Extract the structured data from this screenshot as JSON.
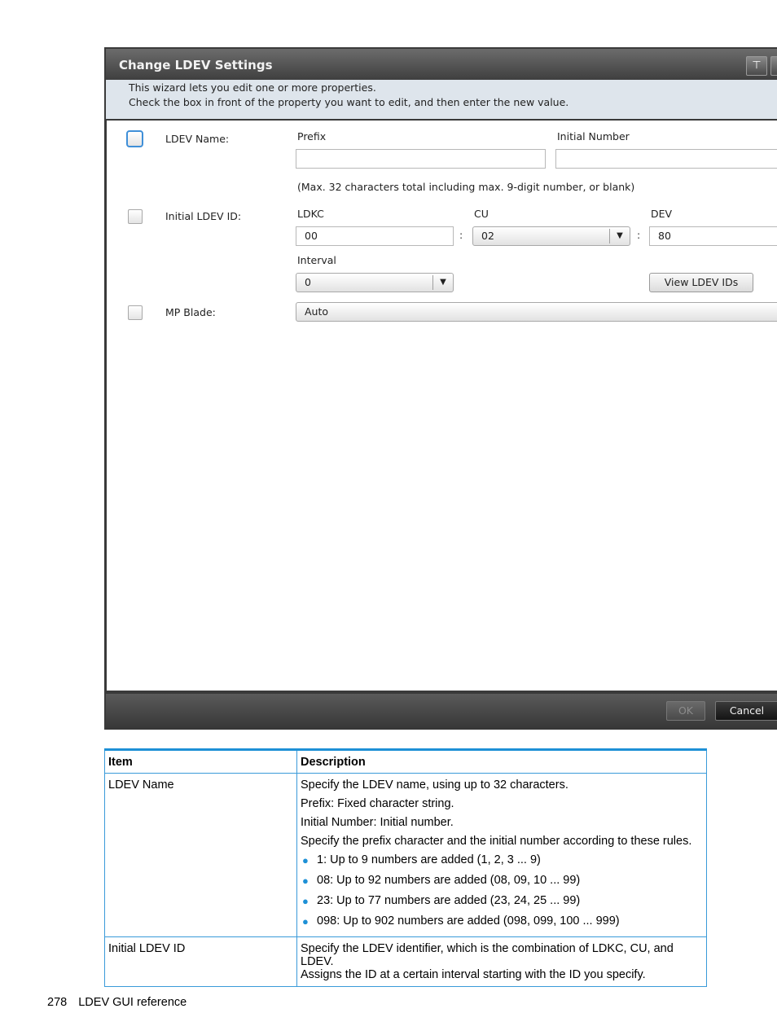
{
  "dialog": {
    "title": "Change LDEV Settings",
    "title_buttons": [
      "⊤"
    ],
    "intro_line1": "This wizard lets you edit one or more properties.",
    "intro_line2": "Check the  box in front of the property you want to edit, and then enter the new value.",
    "ldev_name": {
      "label": "LDEV Name:",
      "prefix_label": "Prefix",
      "prefix_value": "",
      "initial_number_label": "Initial Number",
      "initial_number_value": "",
      "hint": "(Max. 32 characters total including max. 9-digit number, or blank)"
    },
    "initial_ldev_id": {
      "label": "Initial LDEV ID:",
      "ldkc_label": "LDKC",
      "ldkc_value": "00",
      "cu_label": "CU",
      "cu_value": "02",
      "dev_label": "DEV",
      "dev_value": "80",
      "separator": ":",
      "interval_label": "Interval",
      "interval_value": "0",
      "view_ids_button": "View LDEV IDs"
    },
    "mp_blade": {
      "label": "MP Blade:",
      "value": "Auto"
    },
    "footer": {
      "ok_label": "OK",
      "cancel_label": "Cancel"
    }
  },
  "table": {
    "headers": [
      "Item",
      "Description"
    ],
    "rows": [
      {
        "item": "LDEV Name",
        "paragraphs": [
          "Specify the LDEV name, using up to 32 characters.",
          "Prefix: Fixed character string.",
          "Initial Number: Initial number.",
          "Specify the prefix character and the initial number according to these rules."
        ],
        "bullets": [
          "1: Up to 9 numbers are added (1, 2, 3 ... 9)",
          "08: Up to 92 numbers are added (08, 09, 10 ... 99)",
          "23: Up to 77 numbers are added (23, 24, 25 ... 99)",
          "098: Up to 902 numbers are added (098, 099, 100 ... 999)"
        ]
      },
      {
        "item": "Initial LDEV ID",
        "paragraphs": [
          "Specify the LDEV identifier, which is the combination of LDKC, CU, and LDEV.",
          "Assigns the ID at a certain interval starting with the ID you specify."
        ]
      }
    ]
  },
  "page_footer": {
    "page_number": "278",
    "section": "LDEV GUI reference"
  }
}
